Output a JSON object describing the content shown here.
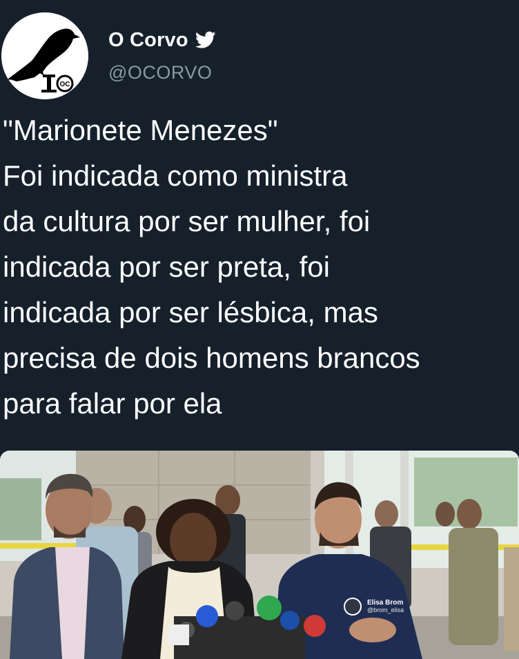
{
  "tweet": {
    "author": {
      "display_name": "O Corvo",
      "handle": "@OCORVO",
      "verified_icon": "twitter-bird-icon",
      "avatar_icon": "crow-logo"
    },
    "text_lines": [
      "\"Marionete Menezes\"",
      "Foi indicada como ministra",
      "da cultura por ser mulher, foi",
      "indicada por ser preta, foi",
      "indicada por ser lésbica, mas",
      "precisa de dois homens brancos",
      "para falar por ela"
    ],
    "media": {
      "watermark_name": "Elisa Brom",
      "watermark_handle": "@brom_elisa"
    }
  },
  "colors": {
    "background": "#15202b",
    "text": "#ffffff",
    "secondary_text": "#8b98a5",
    "twitter_blue": "#ffffff"
  }
}
